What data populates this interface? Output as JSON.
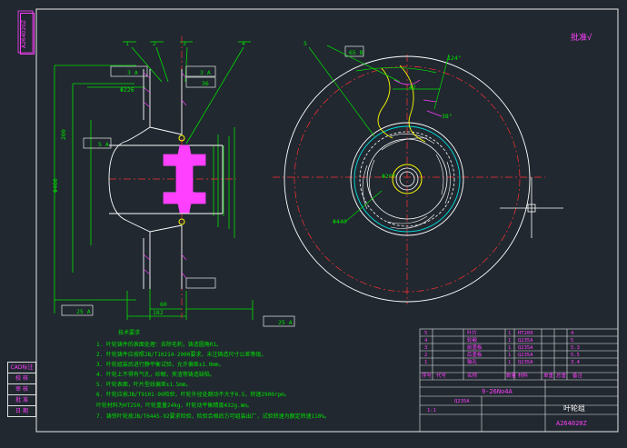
{
  "drawing_number": "A264020Z",
  "drawing_number_rotated": "A264020Z",
  "stamp": "批准√",
  "side_tabs": [
    "CAD标注",
    "校 核",
    "审 核",
    "批 准",
    "日 期"
  ],
  "section_labels": {
    "n1": "1",
    "n2": "2",
    "n3": "3",
    "n4": "4",
    "n5": "5"
  },
  "dims": {
    "d_right_top": "Φ226",
    "d_200": "200",
    "d_460": "Φ460",
    "d_bottom_60": "60",
    "d_bottom_182": "182",
    "d_center_200": "Φ200",
    "d_ring_440": "Φ440",
    "d_angle": "124°",
    "d_r42": "42",
    "d_38": "38°",
    "tol1": "3 A",
    "tol2": "36",
    "tol3": "25 A",
    "tol4": "25 A",
    "tol5": "3 A",
    "tol6": "5 A",
    "tol7": "65 B"
  },
  "notes": {
    "title": "技术要求",
    "lines": [
      "1. 叶轮铸件的表面处理：去除毛刺，铸造圆角R1。",
      "2. 叶轮铸件应按照JB/T10214-2000要求，未注铸造尺寸公差等级。",
      "3. 叶轮组装后进行静平衡试验，允许偏差±1.0mm。",
      "4. 叶轮上不得有气孔，砂眼，夹渣等铸造缺陷。",
      "5. 叶轮表面，叶片型线偏差±1.5mm。",
      "6. 叶轮应按JB/T9101-99检验，叶轮外径处跳动不大于0.5，转速2900rpm。",
      "   叶轮材料为HT250，叶轮重量24kg，叶轮动平衡精度432g.mm。",
      "7. 铸铁叶轮按JB/T6445-92要求检验，检验合格后方可组装出厂，试验转速为额定转速110%。"
    ]
  },
  "title_block": {
    "rows": [
      {
        "n": "5",
        "name": "叶片",
        "qty": "1",
        "mat": "HT200",
        "note": "4"
      },
      {
        "n": "4",
        "name": "轮毂",
        "qty": "1",
        "mat": "Q235A",
        "note": "5"
      },
      {
        "n": "3",
        "name": "前盖板",
        "qty": "1",
        "mat": "Q235A",
        "note": "5.3"
      },
      {
        "n": "2",
        "name": "后盖板",
        "qty": "1",
        "mat": "Q235A",
        "note": "5.5"
      },
      {
        "n": "1",
        "name": "轴孔",
        "qty": "1",
        "mat": "Q235A",
        "note": "3.4"
      }
    ],
    "header": [
      "序号",
      "代号",
      "名称",
      "数量",
      "材料",
      "单重",
      "总重",
      "备注"
    ],
    "model": "9-26No4A",
    "material": "Q235A",
    "part_name": "叶轮组",
    "drawing_no": "A264020Z",
    "scale_row": "1:1"
  }
}
